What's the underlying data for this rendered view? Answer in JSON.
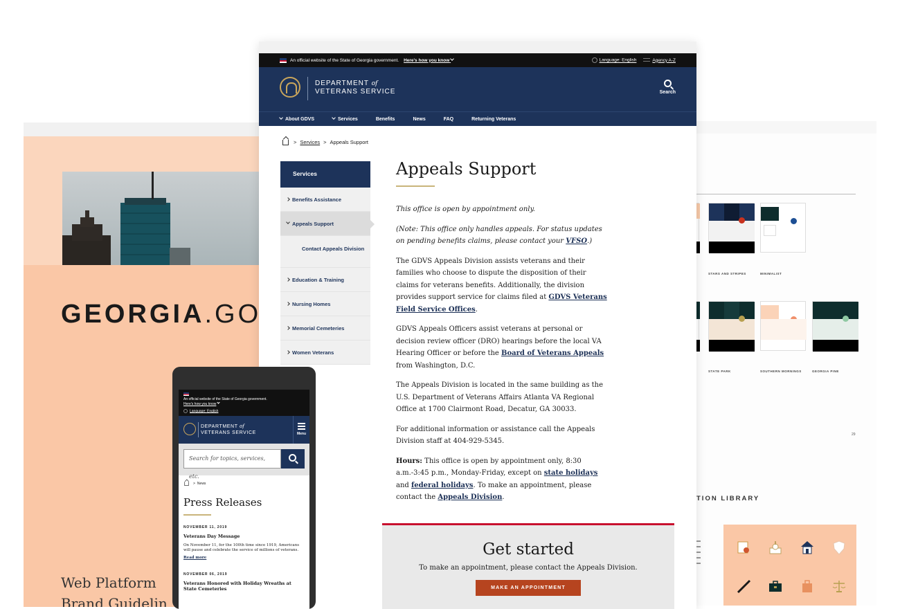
{
  "left_card": {
    "logo_bold": "GEORGIA",
    "logo_rest": ".GO",
    "subtitle_line1": "Web Platform",
    "subtitle_line2": "Brand Guidelin"
  },
  "right_card": {
    "swatches": [
      {
        "label": "STARS AND STRIPES"
      },
      {
        "label": "MINIMALIST"
      },
      {
        "label": "STATE PARK"
      },
      {
        "label": "SOUTHERN MORNINGS"
      },
      {
        "label": "GEORGIA PINE"
      }
    ],
    "section_label": "TION LIBRARY",
    "page_number": "29",
    "icons": [
      "certificate-icon",
      "capitol-icon",
      "house-icon",
      "shield-icon",
      "rifle-icon",
      "briefcase-icon",
      "bag-icon",
      "scales-icon"
    ]
  },
  "desktop": {
    "gov_banner": {
      "text": "An official website of the State of Georgia government.",
      "how_link": "Here's how you know",
      "language": "Language: English",
      "agency": "Agency A-Z"
    },
    "header": {
      "dept_line1_pre": "DEPARTMENT",
      "dept_of": "of",
      "dept_line2": "VETERANS SERVICE",
      "search_label": "Search"
    },
    "nav": [
      {
        "label": "About GDVS",
        "has_chevron": true
      },
      {
        "label": "Services",
        "has_chevron": true
      },
      {
        "label": "Benefits"
      },
      {
        "label": "News"
      },
      {
        "label": "FAQ"
      },
      {
        "label": "Returning Veterans"
      }
    ],
    "breadcrumb": {
      "parent": "Services",
      "current": "Appeals Support"
    },
    "sidebar": {
      "heading": "Services",
      "items": [
        "Benefits Assistance",
        "Appeals Support",
        "Contact Appeals Division",
        "Education & Training",
        "Nursing Homes",
        "Memorial Cemeteries",
        "Women Veterans"
      ]
    },
    "content": {
      "title": "Appeals Support",
      "p1": "This office is open by appointment only.",
      "p2_pre": "(Note: This office only handles appeals. For status updates on pending benefits claims, please contact your ",
      "p2_link": "VFSO",
      "p2_post": ".)",
      "p3_pre": "The GDVS Appeals Division assists veterans and their families who choose to dispute the disposition of their claims for veterans benefits. Additionally, the division provides support service for claims filed at ",
      "p3_link": "GDVS Veterans Field Service Offices",
      "p3_post": ".",
      "p4_pre": "GDVS Appeals Officers assist veterans at personal or decision review officer (DRO) hearings before the local VA Hearing Officer or before the ",
      "p4_link": "Board of Veterans Appeals",
      "p4_post": " from Washington, D.C.",
      "p5": "The Appeals Division is located in the same building as the U.S. Department of Veterans Affairs Atlanta VA Regional Office at 1700 Clairmont Road, Decatur, GA 30033.",
      "p6": "For additional information or assistance call the Appeals Division staff at 404-929-5345.",
      "p7_label": "Hours:",
      "p7_a": " This office is open by appointment only, 8:30 a.m.-3:45 p.m., Monday-Friday, except on ",
      "p7_link1": "state holidays",
      "p7_b": " and ",
      "p7_link2": "federal holidays",
      "p7_c": ". To make an appointment, please contact the ",
      "p7_link3": "Appeals Division",
      "p7_d": "."
    },
    "get_started": {
      "title": "Get started",
      "text": "To make an appointment, please contact the Appeals Division.",
      "button": "MAKE AN APPOINTMENT"
    }
  },
  "mobile": {
    "banner_text": "An official website of the State of Georgia government.",
    "banner_how": "Here's how you know",
    "banner_lang": "Language: English",
    "dept_line1_pre": "DEPARTMENT",
    "dept_of": "of",
    "dept_line2": "VETERANS SERVICE",
    "menu_label": "Menu",
    "search_placeholder": "Search for topics, services, etc.",
    "breadcrumb_current": "News",
    "title": "Press Releases",
    "releases": [
      {
        "date": "NOVEMBER 11, 2019",
        "headline": "Veterans Day Message",
        "body": "On November 11, for the 100th time since 1919, Americans will pause and celebrate the service of millions of veterans.",
        "more": "Read more"
      },
      {
        "date": "NOVEMBER 06, 2019",
        "headline": "Veterans Honored with Holiday Wreaths at State Cemeteries"
      }
    ]
  }
}
